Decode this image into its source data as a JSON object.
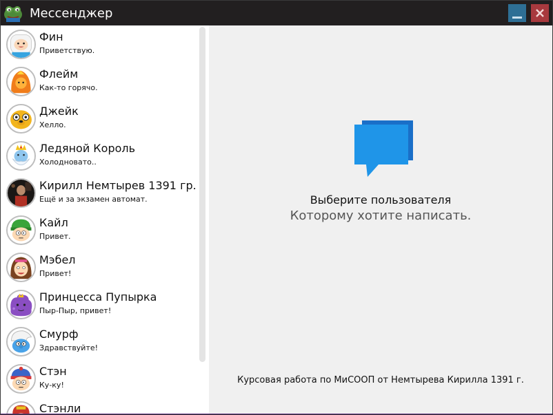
{
  "window": {
    "title": "Мессенджер"
  },
  "contacts": [
    {
      "name": "Фин",
      "message": "Приветствую.",
      "avatar": "finn-avatar"
    },
    {
      "name": "Флейм",
      "message": "Как-то горячо.",
      "avatar": "flame-princess-avatar"
    },
    {
      "name": "Джейк",
      "message": "Хелло.",
      "avatar": "jake-avatar"
    },
    {
      "name": "Ледяной Король",
      "message": "Холодновато..",
      "avatar": "ice-king-avatar"
    },
    {
      "name": "Кирилл Немтырев 1391 гр.",
      "message": "Ещё и за экзамен автомат.",
      "avatar": "photo-avatar"
    },
    {
      "name": "Кайл",
      "message": "Привет.",
      "avatar": "kyle-avatar"
    },
    {
      "name": "Мэбел",
      "message": "Привет!",
      "avatar": "mabel-avatar"
    },
    {
      "name": "Принцесса Пупырка",
      "message": "Пыр-Пыр, привет!",
      "avatar": "lumpy-space-princess-avatar"
    },
    {
      "name": "Смурф",
      "message": "Здравствуйте!",
      "avatar": "smurf-avatar"
    },
    {
      "name": "Стэн",
      "message": "Ку-ку!",
      "avatar": "stan-avatar"
    },
    {
      "name": "Стэнли",
      "message": "",
      "avatar": "stanley-avatar"
    }
  ],
  "main": {
    "title": "Выберите пользователя",
    "subtitle": "Которому хотите написать.",
    "footer": "Курсовая работа по МиСООП от Немтырева Кирилла 1391 г."
  },
  "colors": {
    "titlebar": "#221f20",
    "accent": "#1f8fe0",
    "minimize": "#2e6f95",
    "close": "#a8393e"
  }
}
